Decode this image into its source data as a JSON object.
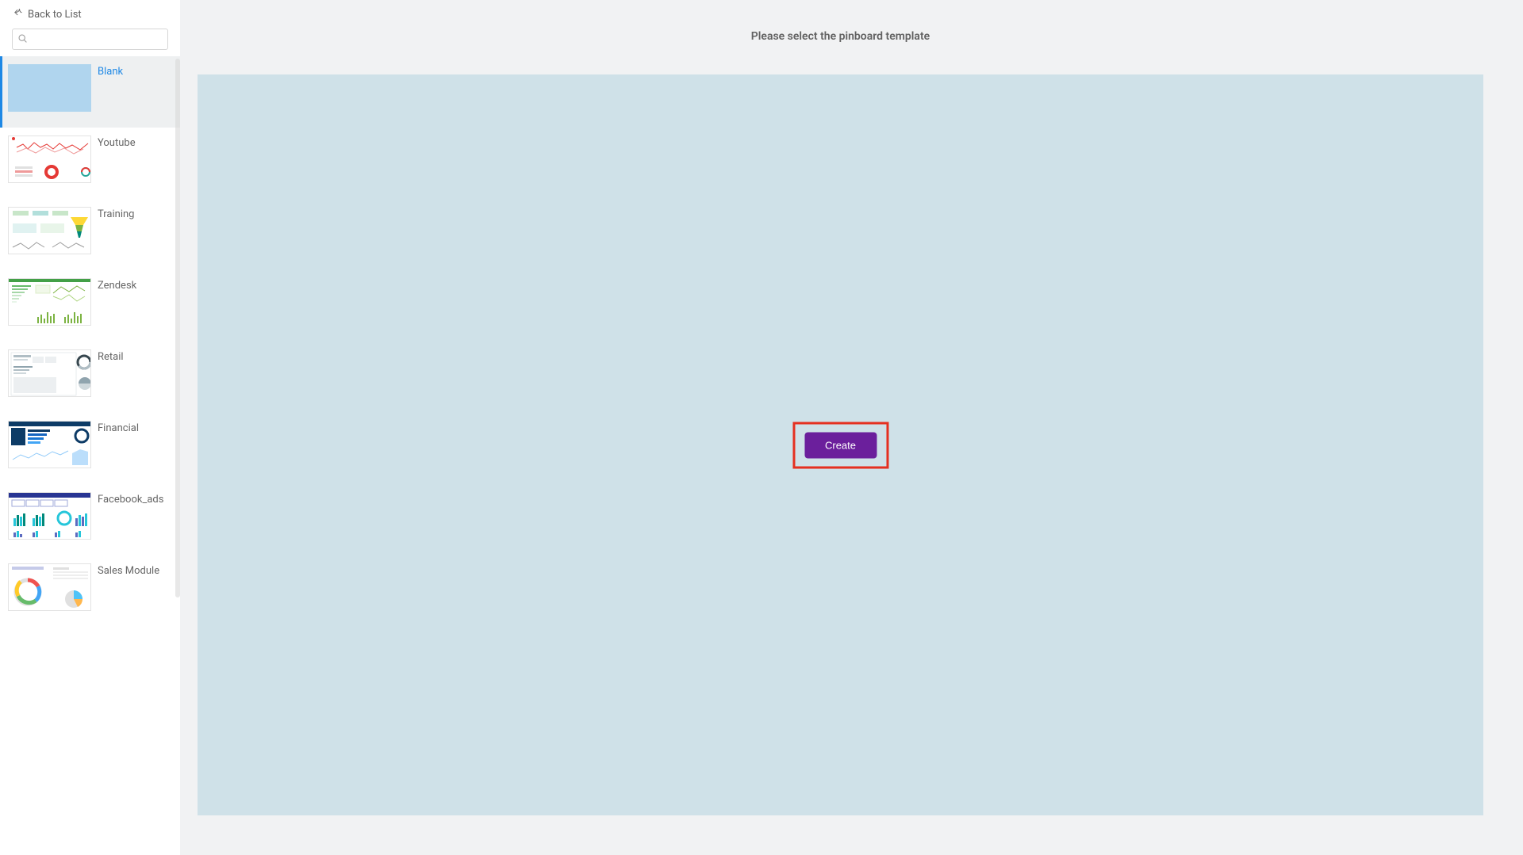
{
  "sidebar": {
    "back_label": "Back to List",
    "search_placeholder": "",
    "templates": [
      {
        "label": "Blank",
        "selected": true
      },
      {
        "label": "Youtube",
        "selected": false
      },
      {
        "label": "Training",
        "selected": false
      },
      {
        "label": "Zendesk",
        "selected": false
      },
      {
        "label": "Retail",
        "selected": false
      },
      {
        "label": "Financial",
        "selected": false
      },
      {
        "label": "Facebook_ads",
        "selected": false
      },
      {
        "label": "Sales Module",
        "selected": false
      }
    ]
  },
  "main": {
    "title": "Please select the pinboard template",
    "create_label": "Create"
  },
  "colors": {
    "accent_blue": "#1e88e5",
    "preview_bg": "#cfe1e8",
    "create_btn_bg": "#6b1f9c",
    "highlight_border": "#e53020",
    "blank_thumb": "#b0d5ee"
  }
}
